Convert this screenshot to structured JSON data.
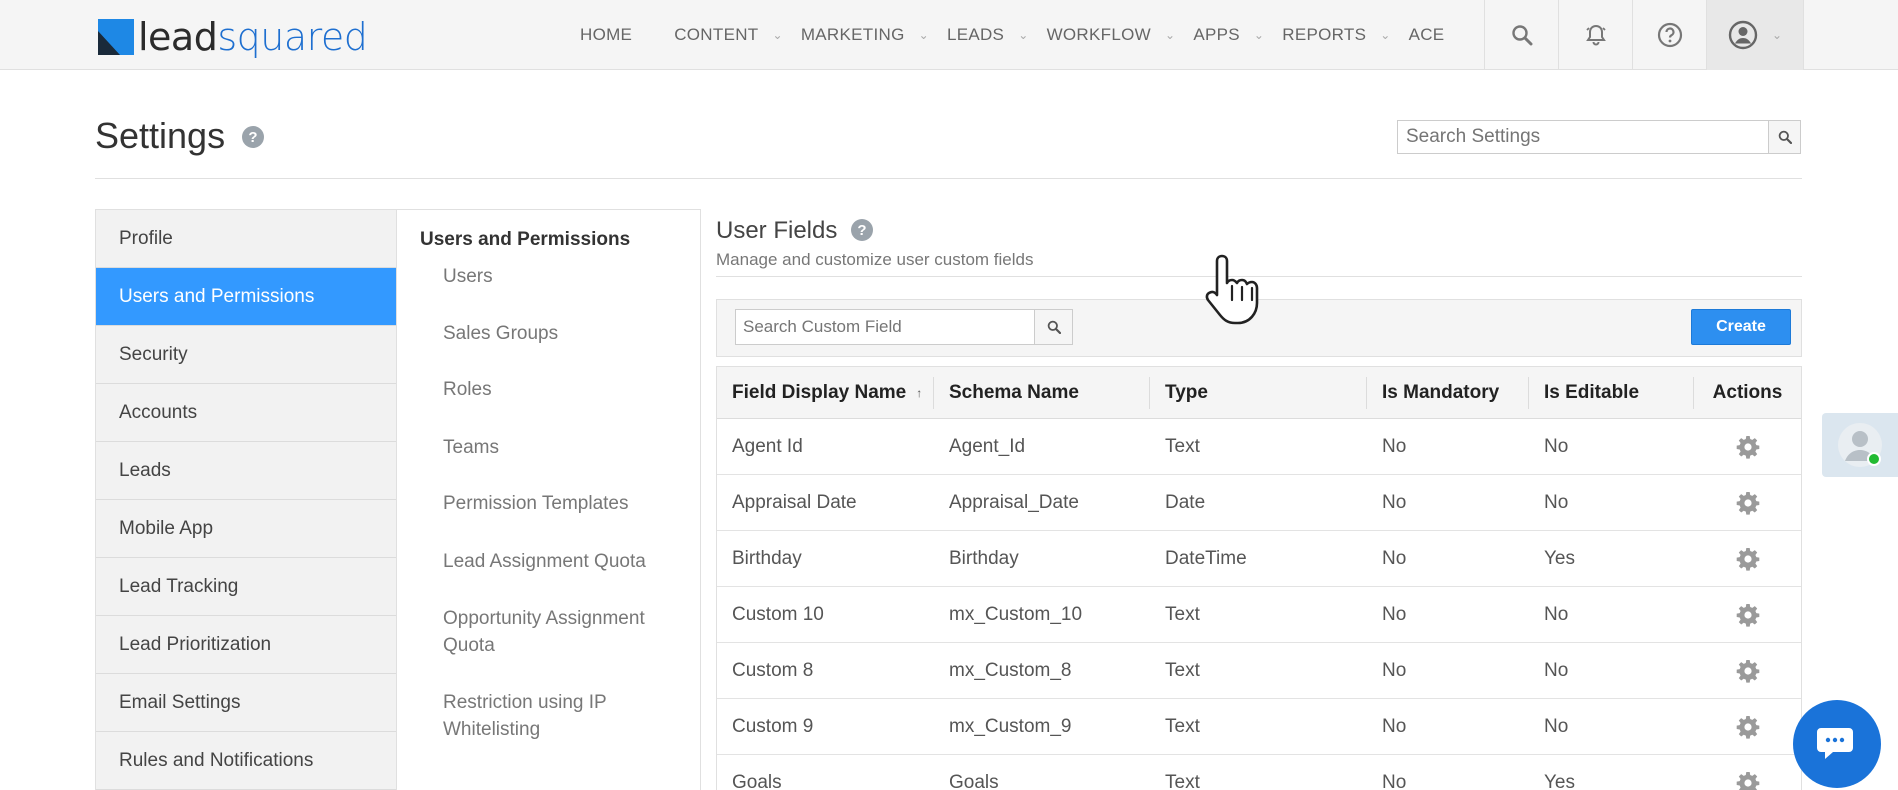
{
  "brand": {
    "logo_lead": "lead",
    "logo_squared": "squared"
  },
  "nav": {
    "items": [
      {
        "label": "HOME",
        "has_dropdown": false
      },
      {
        "label": "CONTENT",
        "has_dropdown": true
      },
      {
        "label": "MARKETING",
        "has_dropdown": true
      },
      {
        "label": "LEADS",
        "has_dropdown": true
      },
      {
        "label": "WORKFLOW",
        "has_dropdown": true
      },
      {
        "label": "APPS",
        "has_dropdown": true
      },
      {
        "label": "REPORTS",
        "has_dropdown": true
      },
      {
        "label": "ACE",
        "has_dropdown": false
      }
    ],
    "icons": [
      "search-icon",
      "bell-icon",
      "help-icon",
      "user-profile-icon"
    ]
  },
  "page": {
    "title": "Settings",
    "search_placeholder": "Search Settings"
  },
  "left_menu": {
    "items": [
      "Profile",
      "Users and Permissions",
      "Security",
      "Accounts",
      "Leads",
      "Mobile App",
      "Lead Tracking",
      "Lead Prioritization",
      "Email Settings",
      "Rules and Notifications"
    ],
    "active_index": 1
  },
  "sub_menu": {
    "heading": "Users and Permissions",
    "items": [
      "Users",
      "Sales Groups",
      "Roles",
      "Teams",
      "Permission Templates",
      "Lead Assignment Quota",
      "Opportunity Assignment Quota",
      "Restriction using IP Whitelisting"
    ]
  },
  "content": {
    "title": "User Fields",
    "subtitle": "Manage and customize user custom fields",
    "search_placeholder": "Search Custom Field",
    "create_label": "Create"
  },
  "table": {
    "columns": [
      "Field Display Name",
      "Schema Name",
      "Type",
      "Is Mandatory",
      "Is Editable",
      "Actions"
    ],
    "sorted_column": 0,
    "rows": [
      [
        "Agent Id",
        "Agent_Id",
        "Text",
        "No",
        "No"
      ],
      [
        "Appraisal Date",
        "Appraisal_Date",
        "Date",
        "No",
        "No"
      ],
      [
        "Birthday",
        "Birthday",
        "DateTime",
        "No",
        "Yes"
      ],
      [
        "Custom 10",
        "mx_Custom_10",
        "Text",
        "No",
        "No"
      ],
      [
        "Custom 8",
        "mx_Custom_8",
        "Text",
        "No",
        "No"
      ],
      [
        "Custom 9",
        "mx_Custom_9",
        "Text",
        "No",
        "No"
      ],
      [
        "Goals",
        "Goals",
        "Text",
        "No",
        "Yes"
      ]
    ]
  },
  "colors": {
    "accent": "#3399ff",
    "primary_button": "#2d8ff0",
    "chat_button": "#1a73d9",
    "online_status": "#22bb33"
  }
}
